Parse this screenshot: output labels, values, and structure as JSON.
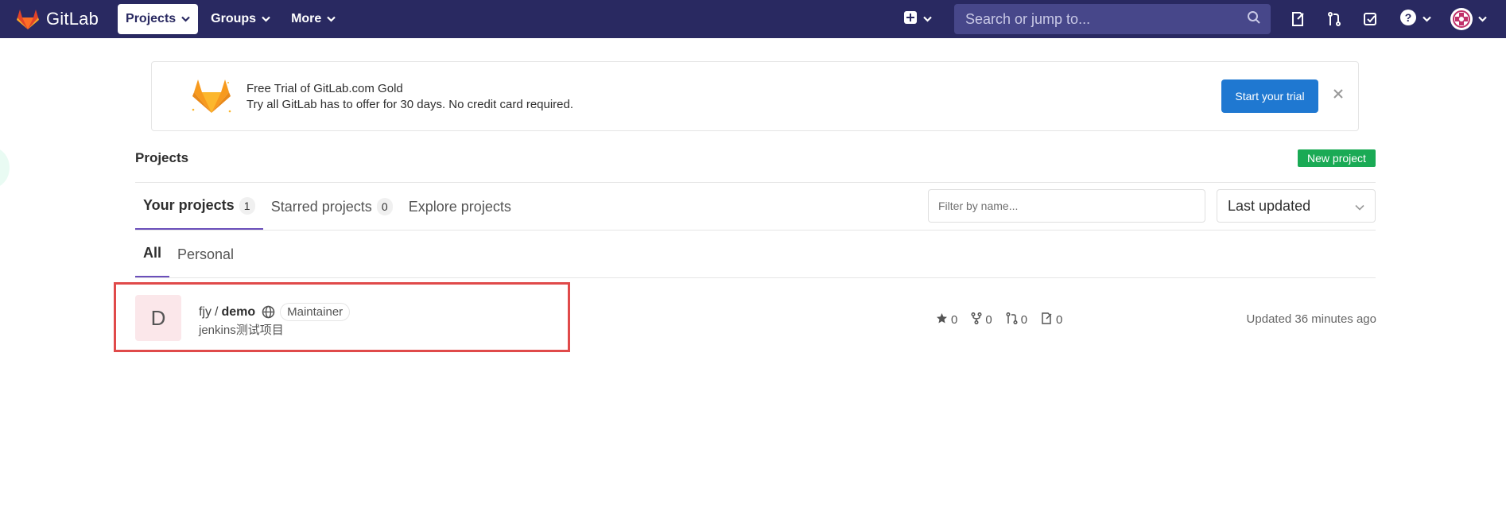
{
  "navbar": {
    "brand": "GitLab",
    "menu": [
      {
        "label": "Projects",
        "active": true
      },
      {
        "label": "Groups",
        "active": false
      },
      {
        "label": "More",
        "active": false
      }
    ],
    "search_placeholder": "Search or jump to..."
  },
  "banner": {
    "title": "Free Trial of GitLab.com Gold",
    "description": "Try all GitLab has to offer for 30 days. No credit card required.",
    "cta_label": "Start your trial"
  },
  "page": {
    "title": "Projects",
    "new_project_label": "New project"
  },
  "tabs": [
    {
      "label": "Your projects",
      "count": "1",
      "active": true
    },
    {
      "label": "Starred projects",
      "count": "0",
      "active": false
    },
    {
      "label": "Explore projects",
      "count": null,
      "active": false
    }
  ],
  "filter": {
    "placeholder": "Filter by name..."
  },
  "sort": {
    "selected": "Last updated"
  },
  "subtabs": [
    {
      "label": "All",
      "active": true
    },
    {
      "label": "Personal",
      "active": false
    }
  ],
  "projects": [
    {
      "avatar_letter": "D",
      "namespace": "fjy",
      "separator": "/",
      "name": "demo",
      "role": "Maintainer",
      "description": "jenkins测试项目",
      "stars": "0",
      "forks": "0",
      "merge_requests": "0",
      "issues": "0",
      "updated": "Updated 36 minutes ago"
    }
  ],
  "colors": {
    "navbar": "#292961",
    "search": "#47478a",
    "primary": "#1f78d1",
    "success": "#1aaa55",
    "tab_active": "#6b4fbb",
    "highlight": "#e04a4a"
  }
}
